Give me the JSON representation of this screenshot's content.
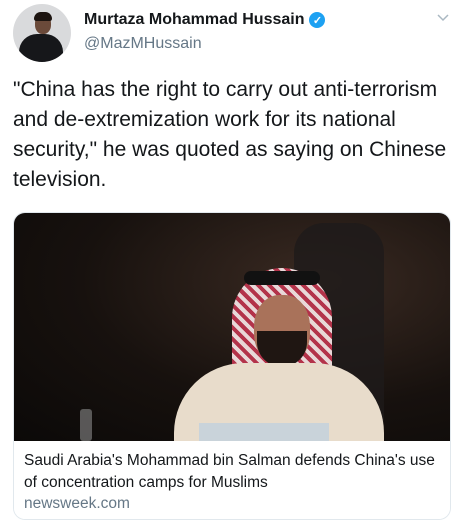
{
  "tweet": {
    "author_name": "Murtaza Mohammad Hussain",
    "handle": "@MazMHussain",
    "verified": true,
    "text": "\"China has the right to carry out anti-terrorism and de-extremization work for its national security,\" he was quoted as saying on Chinese television.",
    "menu_icon": "chevron-down-icon"
  },
  "card": {
    "headline": "Saudi Arabia's Mohammad bin Salman defends China's use of concentration camps for Muslims",
    "domain": "newsweek.com"
  },
  "colors": {
    "verified": "#1da1f2",
    "secondary_text": "#657786"
  }
}
